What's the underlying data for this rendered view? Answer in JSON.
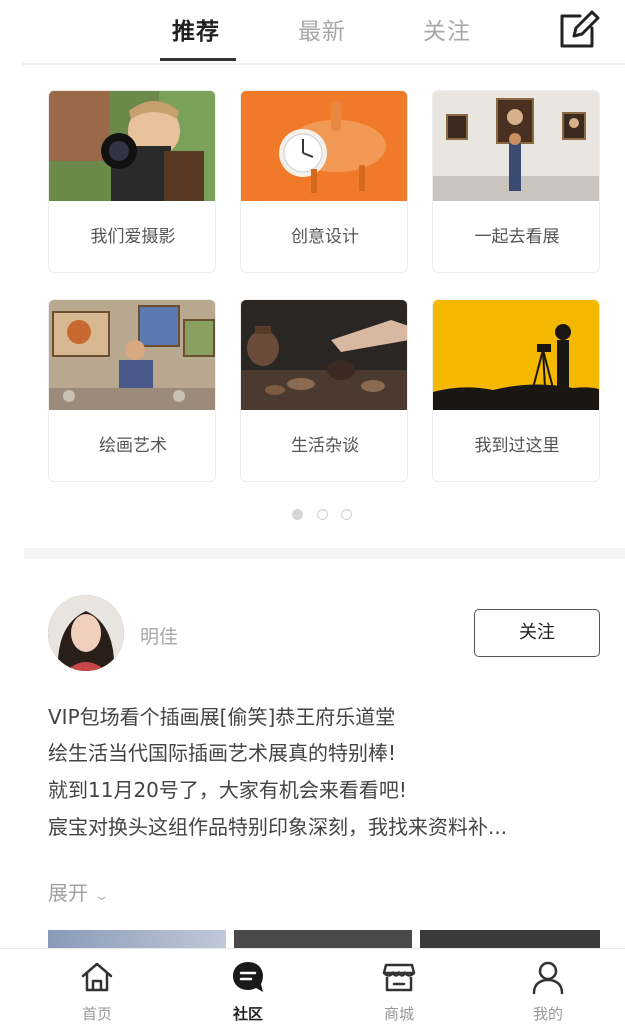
{
  "top_tabs": [
    {
      "label": "推荐",
      "active": true
    },
    {
      "label": "最新",
      "active": false
    },
    {
      "label": "关注",
      "active": false
    }
  ],
  "compose_icon": "compose-icon",
  "categories": [
    {
      "label": "我们爱摄影",
      "icon": "photography-image"
    },
    {
      "label": "创意设计",
      "icon": "design-image"
    },
    {
      "label": "一起去看展",
      "icon": "exhibition-image"
    },
    {
      "label": "绘画艺术",
      "icon": "painting-image"
    },
    {
      "label": "生活杂谈",
      "icon": "tea-life-image"
    },
    {
      "label": "我到过这里",
      "icon": "travel-silhouette-image"
    }
  ],
  "pagination": {
    "pages": 3,
    "current": 1
  },
  "post": {
    "username": "明佳",
    "follow_label": "关注",
    "lines": [
      "VIP包场看个插画展[偷笑]恭王府乐道堂",
      "绘生活当代国际插画艺术展真的特别棒!",
      "就到11月20号了，大家有机会来看看吧!",
      "宸宝对换头这组作品特别印象深刻，我找来资料补..."
    ],
    "expand_label": "展开",
    "expand_icon": "chevron-down-icon"
  },
  "bottom_nav": [
    {
      "label": "首页",
      "icon": "home-icon",
      "active": false
    },
    {
      "label": "社区",
      "icon": "chat-bubble-icon",
      "active": true
    },
    {
      "label": "商城",
      "icon": "store-icon",
      "active": false
    },
    {
      "label": "我的",
      "icon": "person-icon",
      "active": false
    }
  ],
  "colors": {
    "accent": "#222222",
    "inactive": "#a8a8a8",
    "divider": "#efefef",
    "orange_card": "#f07a2a",
    "yellow_card": "#f5b800"
  }
}
